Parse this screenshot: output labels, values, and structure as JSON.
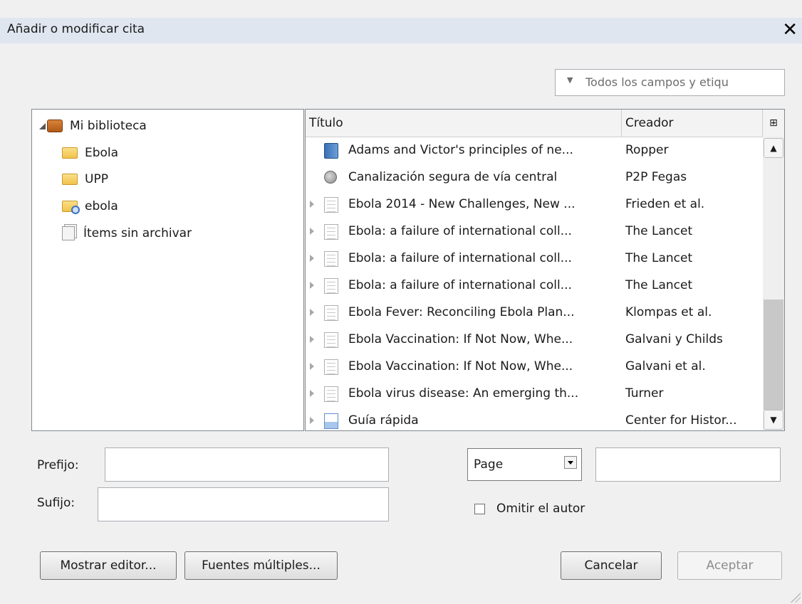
{
  "window": {
    "title": "Añadir o modificar cita",
    "close_glyph": "✕"
  },
  "search": {
    "placeholder": "Todos los campos y etiqu"
  },
  "tree": {
    "items": [
      {
        "label": "Mi biblioteca",
        "icon": "library-icon"
      },
      {
        "label": "Ebola",
        "icon": "folder-icon"
      },
      {
        "label": "UPP",
        "icon": "folder-icon"
      },
      {
        "label": "ebola",
        "icon": "saved-search-icon"
      },
      {
        "label": "Ítems sin archivar",
        "icon": "unfiled-items-icon"
      }
    ]
  },
  "list": {
    "headers": {
      "title": "Título",
      "creator": "Creador"
    },
    "rows": [
      {
        "title": "Adams and Victor's principles of ne...",
        "creator": "Ropper",
        "icon": "book-icon"
      },
      {
        "title": "Canalización segura de vía central",
        "creator": "P2P Fegas",
        "icon": "webpage-icon"
      },
      {
        "title": "Ebola 2014 - New Challenges, New ...",
        "creator": "Frieden et al.",
        "icon": "article-icon"
      },
      {
        "title": "Ebola: a failure of international coll...",
        "creator": "The Lancet",
        "icon": "article-icon"
      },
      {
        "title": "Ebola: a failure of international coll...",
        "creator": "The Lancet",
        "icon": "article-icon"
      },
      {
        "title": "Ebola: a failure of international coll...",
        "creator": "The Lancet",
        "icon": "article-icon"
      },
      {
        "title": "Ebola Fever: Reconciling Ebola Plan...",
        "creator": "Klompas et al.",
        "icon": "article-icon"
      },
      {
        "title": "Ebola Vaccination: If Not Now, Whe...",
        "creator": "Galvani y Childs",
        "icon": "article-icon"
      },
      {
        "title": "Ebola Vaccination: If Not Now, Whe...",
        "creator": "Galvani et al.",
        "icon": "article-icon"
      },
      {
        "title": "Ebola virus disease: An emerging th...",
        "creator": "Turner",
        "icon": "article-icon"
      },
      {
        "title": "Guía rápida",
        "creator": "Center for Histor...",
        "icon": "document-icon"
      }
    ]
  },
  "form": {
    "prefix_label": "Prefijo:",
    "prefix_value": "",
    "suffix_label": "Sufijo:",
    "suffix_value": "",
    "locator_type": "Page",
    "locator_value": "",
    "omit_author_label": "Omitir el autor",
    "omit_author_checked": false
  },
  "buttons": {
    "show_editor": "Mostrar editor...",
    "multiple_sources": "Fuentes múltiples...",
    "cancel": "Cancelar",
    "accept": "Aceptar"
  }
}
